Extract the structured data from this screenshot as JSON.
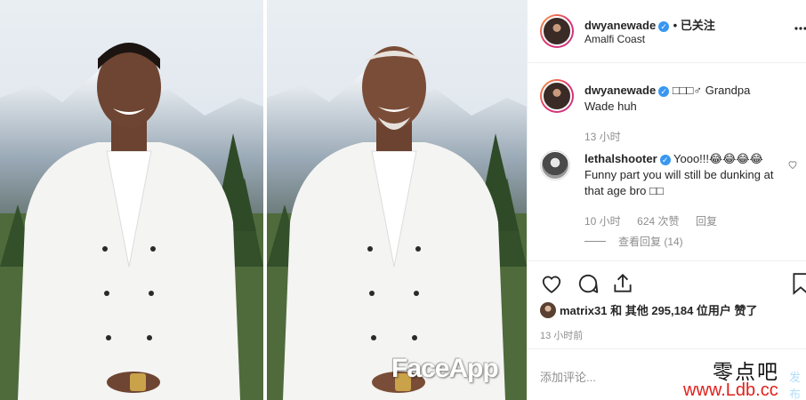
{
  "header": {
    "username": "dwyanewade",
    "follow_status": "• 已关注",
    "location": "Amalfi Coast"
  },
  "caption": {
    "username": "dwyanewade",
    "text": "□□□♂ Grandpa Wade huh",
    "time": "13 小时"
  },
  "comment": {
    "username": "lethalshooter",
    "text": "Yooo!!!😂😂😂😂 Funny part you will still be dunking at that age bro □□",
    "time": "10 小时",
    "likes": "624 次赞",
    "reply_label": "回复",
    "view_replies": "查看回复 (14)"
  },
  "likes_line": {
    "user": "matrix31",
    "text": "和 其他 295,184 位用户 赞了"
  },
  "post_time": "13 小时前",
  "add_comment": {
    "placeholder": "添加评论...",
    "post_label": "发布"
  },
  "photo_watermark": "FaceApp",
  "site_watermark": {
    "title": "零点吧",
    "url": "www.Ldb.cc"
  },
  "icons": {
    "more": "more-icon",
    "like": "heart-icon",
    "comment": "comment-icon",
    "share": "share-icon",
    "save": "bookmark-icon"
  },
  "colors": {
    "verified": "#3897f0",
    "muted": "#8e8e8e",
    "watermark_red": "#e0201b"
  }
}
